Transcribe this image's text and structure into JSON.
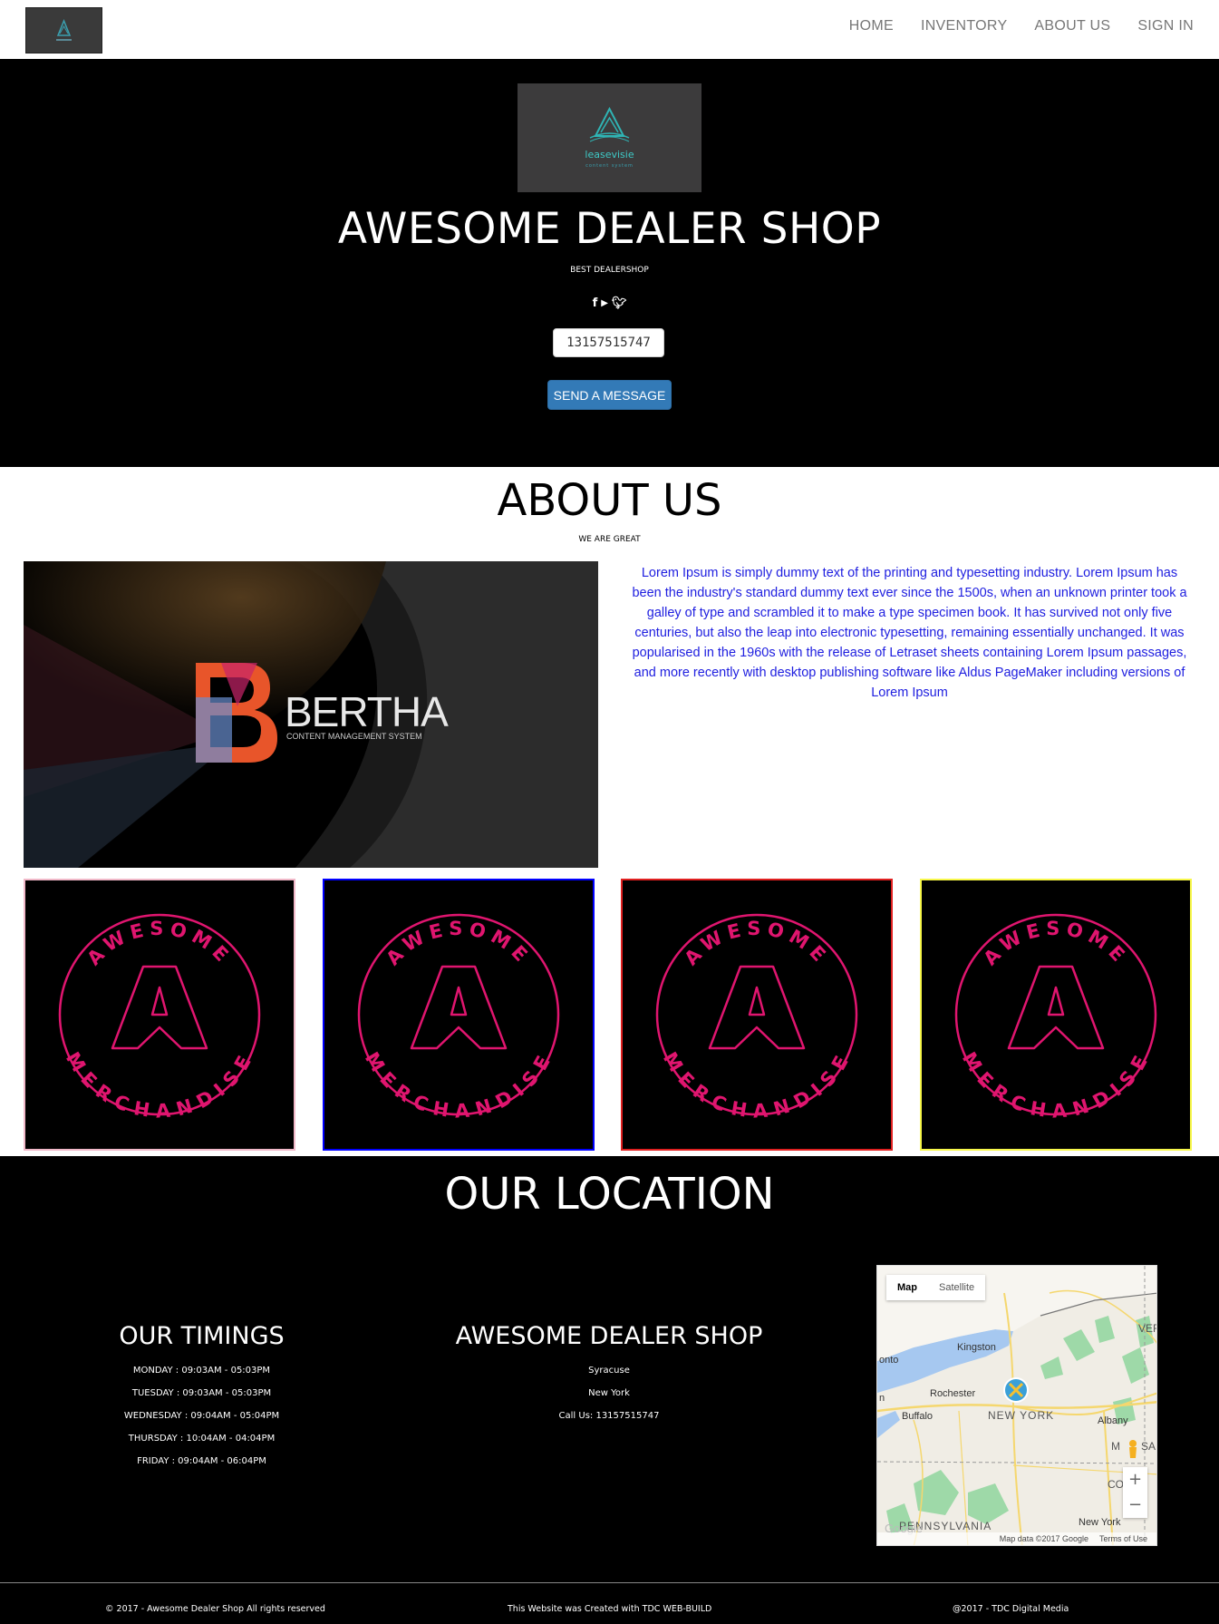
{
  "nav": {
    "logo_alt": "leasevisie",
    "links": [
      "HOME",
      "INVENTORY",
      "ABOUT US",
      "SIGN IN"
    ]
  },
  "hero": {
    "logo_text": "leasevisie",
    "logo_tagline": "content system",
    "title": "AWESOME DEALER SHOP",
    "subtitle": "BEST DEALERSHOP",
    "social_icons": [
      "facebook-icon",
      "youtube-icon",
      "twitter-icon"
    ],
    "phone": "13157515747",
    "send_label": "SEND A MESSAGE"
  },
  "about": {
    "title": "ABOUT US",
    "subtitle": "WE ARE GREAT",
    "image_brand": "BERTHA",
    "image_tagline": "CONTENT MANAGEMENT SYSTEM",
    "text": "Lorem Ipsum is simply dummy text of the printing and typesetting industry. Lorem Ipsum has been the industry's standard dummy text ever since the 1500s, when an unknown printer took a galley of type and scrambled it to make a type specimen book. It has survived not only five centuries, but also the leap into electronic typesetting, remaining essentially unchanged. It was popularised in the 1960s with the release of Letraset sheets containing Lorem Ipsum passages, and more recently with desktop publishing software like Aldus PageMaker including versions of Lorem Ipsum"
  },
  "merch": {
    "top_text": "AWESOME",
    "bottom_text": "MERCHANDISE",
    "logo_letter": "A",
    "colors": {
      "emblem": "#e0156f"
    },
    "border_colors": [
      "#f0b8c8",
      "#0000ff",
      "#e02020",
      "#f7f74a"
    ]
  },
  "location": {
    "title": "OUR LOCATION",
    "timings_title": "OUR TIMINGS",
    "timings": [
      "MONDAY : 09:03AM - 05:03PM",
      "TUESDAY : 09:03AM - 05:03PM",
      "WEDNESDAY : 09:04AM - 05:04PM",
      "THURSDAY : 10:04AM - 04:04PM",
      "FRIDAY : 09:04AM - 06:04PM"
    ],
    "shop_title": "AWESOME DEALER SHOP",
    "shop_lines": [
      "Syracuse",
      "New York",
      "Call Us: 13157515747"
    ],
    "map": {
      "tab_map": "Map",
      "tab_satellite": "Satellite",
      "labels": [
        "Kingston",
        "Rochester",
        "Buffalo",
        "NEW YORK",
        "Albany",
        "VER",
        "onto",
        "n",
        "M",
        "SA",
        "CO",
        "PENNSYLVANIA",
        "New York"
      ],
      "zoom_in": "+",
      "zoom_out": "−",
      "attribution": "Map data ©2017 Google",
      "terms": "Terms of Use",
      "google": "Google"
    }
  },
  "footer": {
    "left": "© 2017 - Awesome Dealer Shop All rights reserved",
    "center": "This Website was Created with TDC WEB-BUILD",
    "right": "@2017 - TDC Digital Media"
  }
}
